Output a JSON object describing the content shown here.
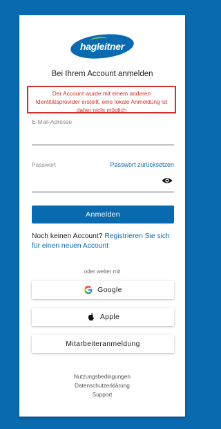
{
  "brand": {
    "logo_text": "hagleitner",
    "primary_color": "#0a6ab0",
    "swoosh_color": "#7ac143"
  },
  "header": {
    "title": "Bei Ihrem Account anmelden"
  },
  "error": {
    "message": "Der Account wurde mit einem anderen Identitätsprovider erstellt, eine lokale Anmeldung ist daher nicht möglich",
    "color": "#d0312d"
  },
  "form": {
    "email_label": "E-Mail-Adresse",
    "email_value": "",
    "password_label": "Passwort",
    "password_value": "",
    "reset_link": "Passwort zurücksetzen",
    "eye_icon": "eye-icon",
    "submit_label": "Anmelden"
  },
  "register": {
    "prefix": "Noch keinen Account?",
    "link": "Registrieren Sie sich für einen neuen Account"
  },
  "social": {
    "divider": "oder weiter mit",
    "google_label": "Google",
    "apple_label": "Apple",
    "employee_label": "Mitarbeiteranmeldung"
  },
  "footer": {
    "terms": "Nutzungsbedingungen",
    "privacy": "Datenschutzerklärung",
    "support": "Support"
  }
}
